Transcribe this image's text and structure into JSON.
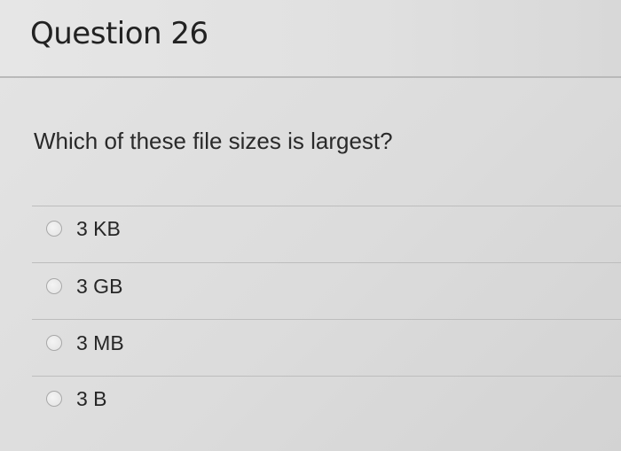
{
  "question": {
    "title": "Question 26",
    "prompt": "Which of these file sizes is largest?",
    "answers": [
      {
        "label": "3 KB"
      },
      {
        "label": "3 GB"
      },
      {
        "label": "3 MB"
      },
      {
        "label": "3 B"
      }
    ]
  },
  "colors": {
    "background": "#dedede",
    "text": "#222222",
    "divider": "#bdbdbd"
  }
}
